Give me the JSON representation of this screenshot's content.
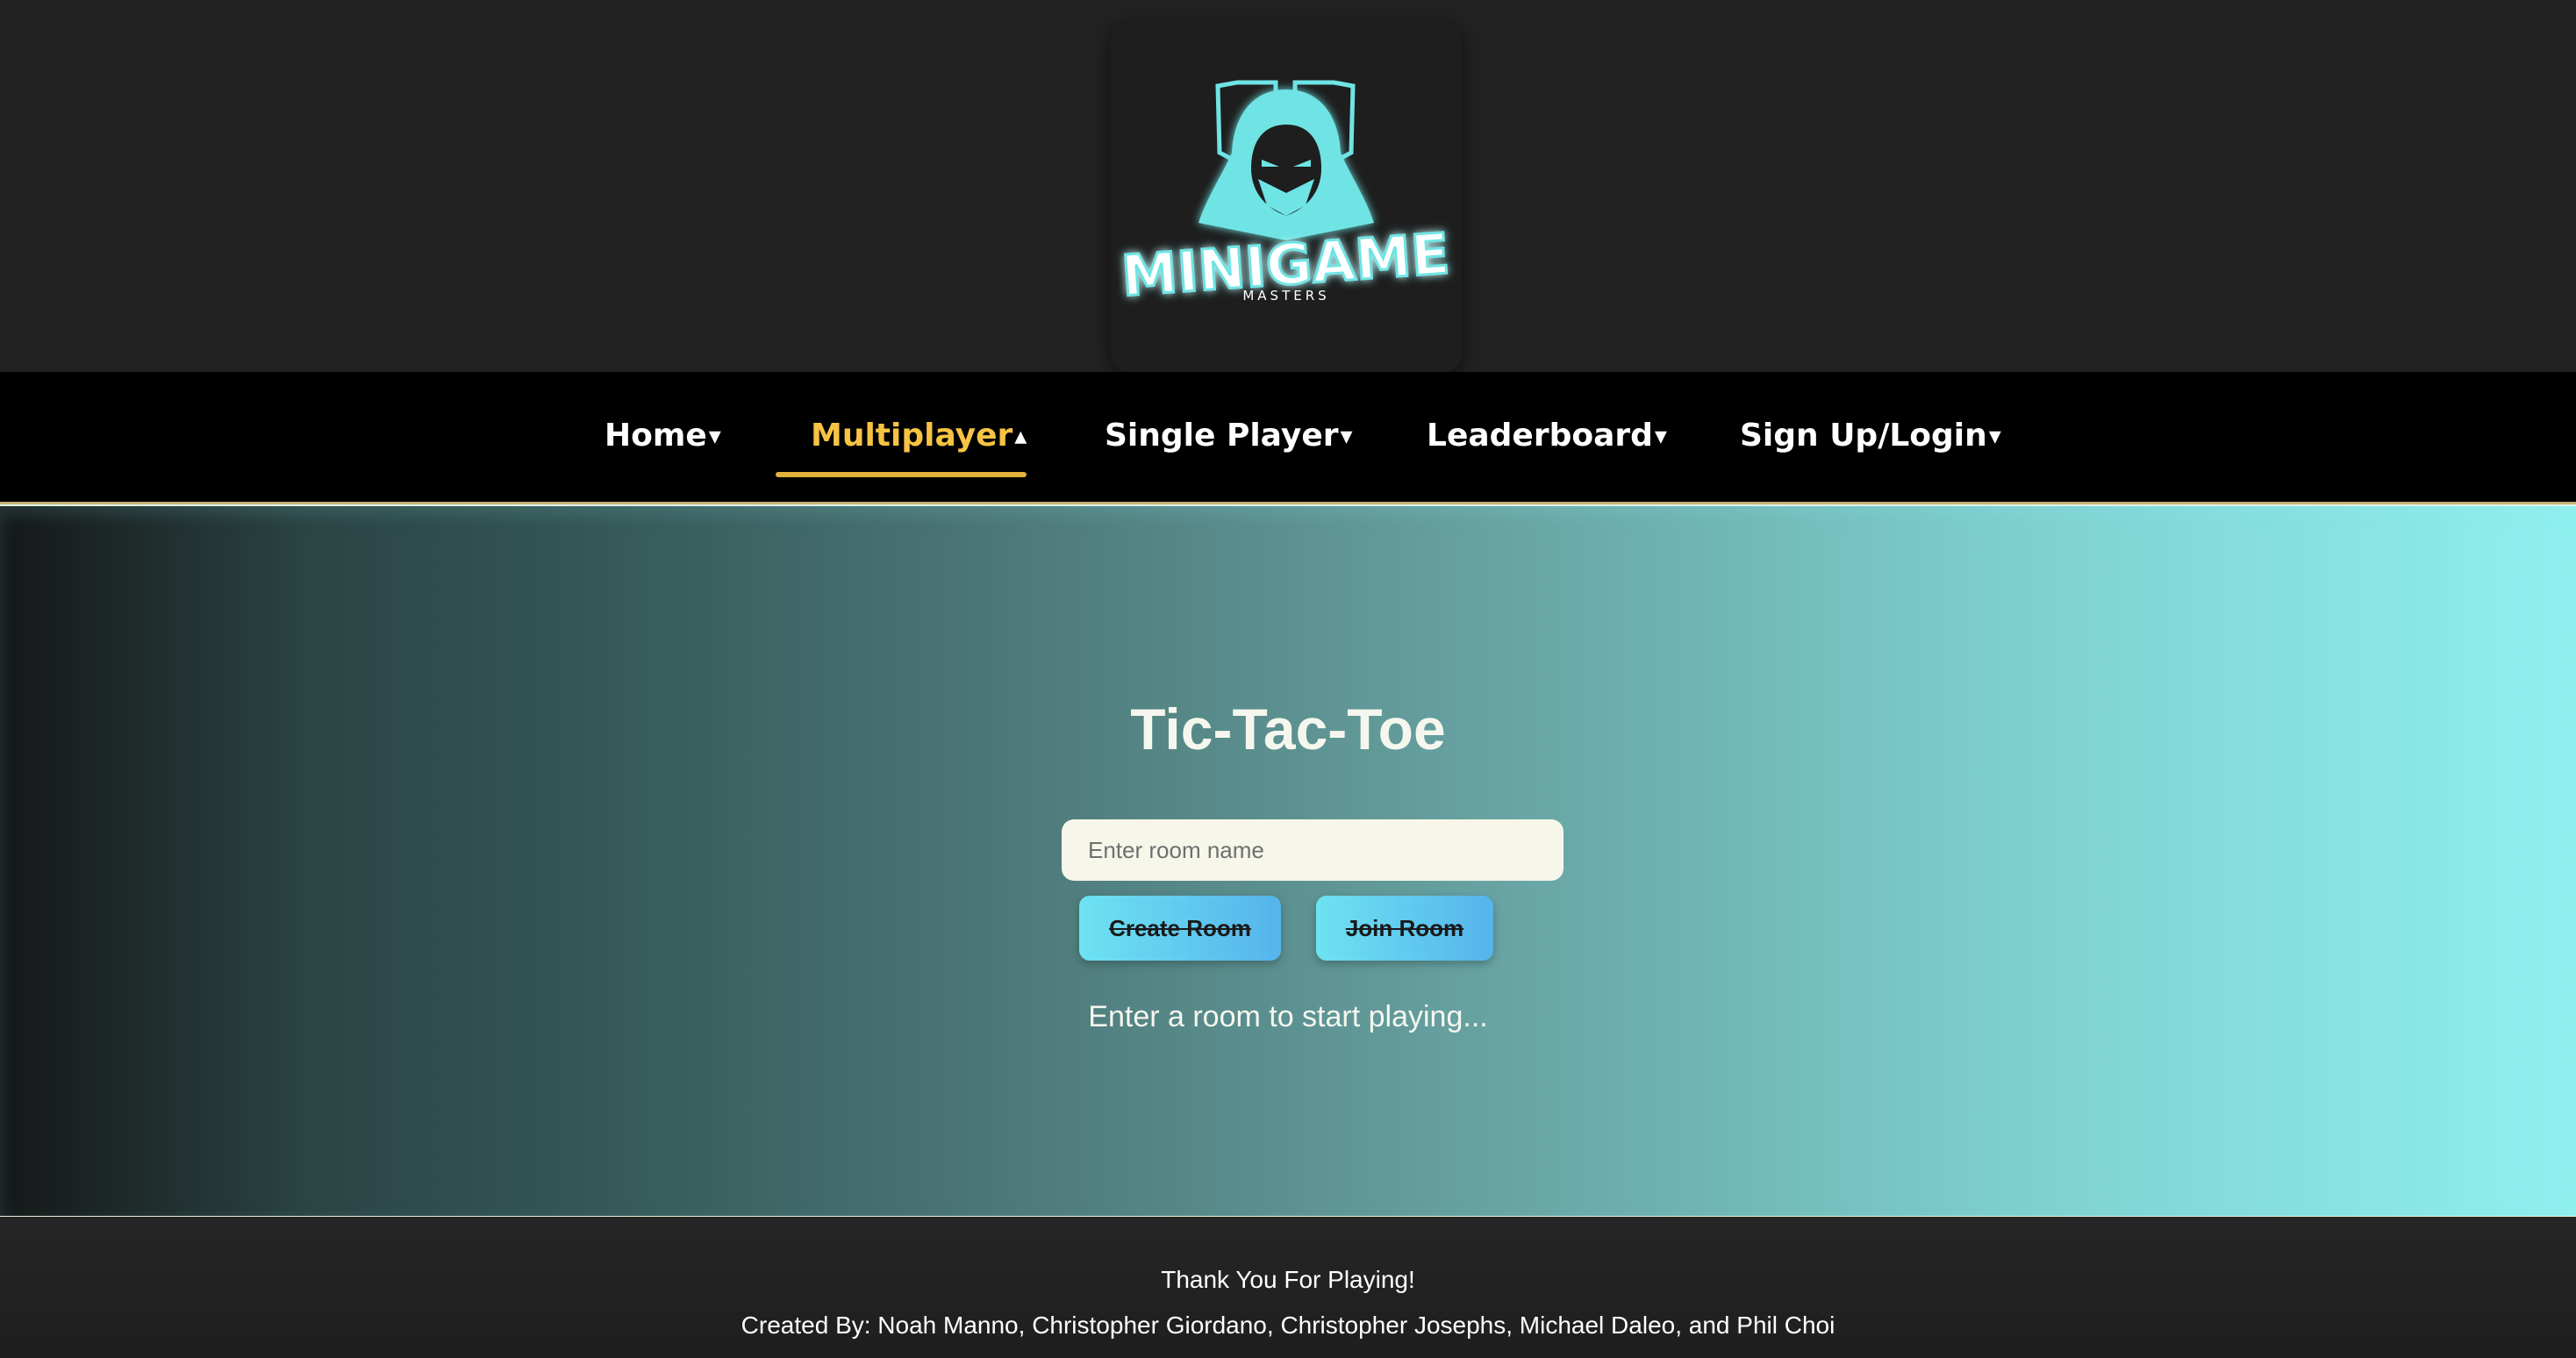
{
  "logo": {
    "wordmark": "MINIGAME",
    "subtitle": "MASTERS",
    "accent_color": "#6fe4e4"
  },
  "nav": {
    "items": [
      {
        "label": "Home",
        "caret": "▾",
        "active": false
      },
      {
        "label": "Multiplayer",
        "caret": "▴",
        "active": true
      },
      {
        "label": "Single Player",
        "caret": "▾",
        "active": false
      },
      {
        "label": "Leaderboard",
        "caret": "▾",
        "active": false
      },
      {
        "label": "Sign Up/Login",
        "caret": "▾",
        "active": false
      }
    ],
    "active_color": "#f6c343"
  },
  "main": {
    "title": "Tic-Tac-Toe",
    "room_input": {
      "placeholder": "Enter room name",
      "value": ""
    },
    "create_button": "Create Room",
    "join_button": "Join Room",
    "status": "Enter a room to start playing..."
  },
  "footer": {
    "thanks": "Thank You For Playing!",
    "credits": "Created By: Noah Manno, Christopher Giordano, Christopher Josephs, Michael Daleo, and Phil Choi"
  }
}
